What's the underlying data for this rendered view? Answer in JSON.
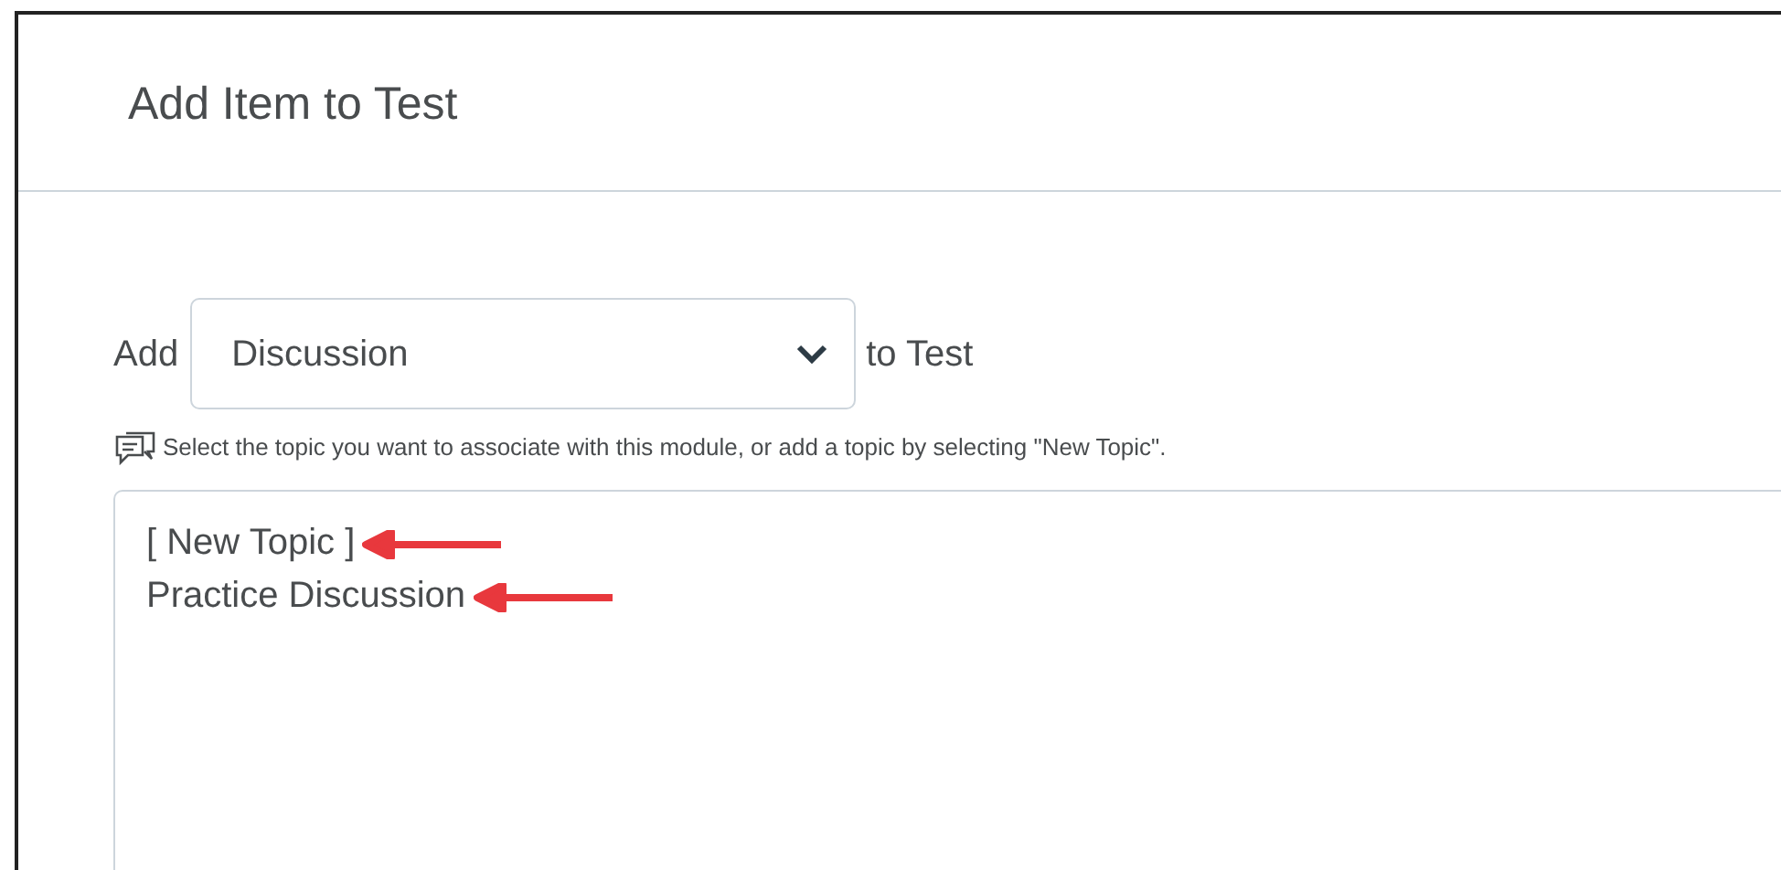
{
  "dialog": {
    "title": "Add Item to Test"
  },
  "add_row": {
    "prefix": "Add",
    "select": {
      "value": "Discussion"
    },
    "suffix": "to Test"
  },
  "help_text": "Select the topic you want to associate with this module, or add a topic by selecting \"New Topic\".",
  "topics": [
    {
      "label": "[ New Topic ]",
      "marked": true
    },
    {
      "label": "Practice Discussion",
      "marked": true
    }
  ]
}
